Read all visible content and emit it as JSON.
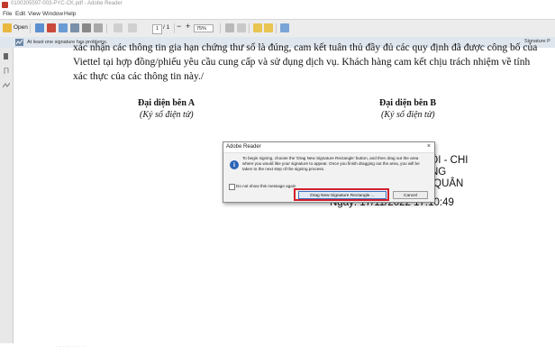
{
  "window": {
    "title": "0100305597-003-PYC-CK.pdf - Adobe Reader"
  },
  "menu": {
    "items": [
      "File",
      "Edit",
      "View",
      "Window",
      "Help"
    ]
  },
  "toolbar": {
    "open_label": "Open",
    "page_current": "1",
    "page_total": "/ 1",
    "zoom": "75%"
  },
  "signature_bar": {
    "message": "At least one signature has problems.",
    "panel_button": "Signature P"
  },
  "document": {
    "lines": [
      "xác nhận các thông tin gia hạn chứng thư số là đúng, cam kết tuân thủ đầy đủ các quy định đã được công bố của",
      "Viettel tại hợp đồng/phiếu yêu cầu cung cấp và sử dụng dịch vụ. Khách hàng cam kết chịu trách nhiệm về tính",
      "xác thực của các thông tin này./"
    ],
    "party_a": {
      "title": "Đại diện bên A",
      "subtitle": "(Ký số điện tử)"
    },
    "party_b": {
      "title": "Đại diện bên B",
      "subtitle": "(Ký số điện tử)"
    },
    "stamp": {
      "line1": "NỘI - CHI",
      "line2": "ÓNG",
      "line3": "G QUÂN",
      "date_line": "Ngày:     17/11/2022 17:10:49"
    }
  },
  "dialog": {
    "title": "Adobe Reader",
    "close": "×",
    "message": "To begin signing, choose the 'Drag New Signature Rectangle' button, and then drag out the area where you would like your signature to appear. Once you finish dragging out the area, you will be taken to the next step of the signing process.",
    "checkbox_label": "Do not show this message again",
    "primary_button": "Drag New Signature Rectangle ...",
    "cancel_button": "Cancel"
  },
  "footer": {
    "text": "· ·  ·  · ·  ·  · ·  ·"
  },
  "colors": {
    "highlight": "#d11f2b",
    "info_icon": "#2d63b7",
    "toolbar_bg": "#ececec"
  }
}
